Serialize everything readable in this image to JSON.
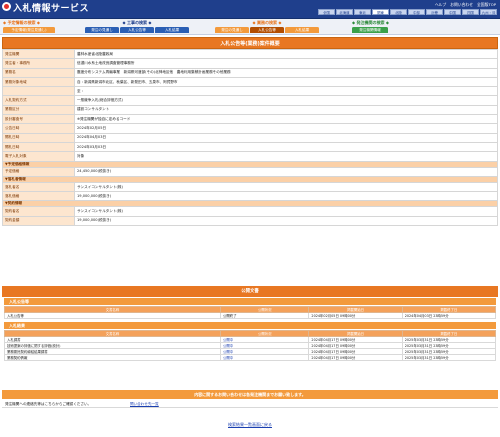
{
  "header": {
    "title": "入札情報サービス",
    "toplinks": [
      "ヘルプ",
      "お問い合わせ",
      "全国版TOP"
    ],
    "regions": [
      "全国",
      "北海道",
      "東北",
      "関東",
      "北陸",
      "中部",
      "近畿",
      "中国",
      "四国",
      "九州・沖縄"
    ],
    "selected_region": "関東"
  },
  "menu": {
    "groups": [
      {
        "head": "◆ 予定情報の検索 ◆",
        "tabs": [
          "予定情報(発注見通し)"
        ]
      },
      {
        "head": "◆ 工事の検索 ◆",
        "tabs": [
          "発注の見通し",
          "入札公告等",
          "入札結果"
        ]
      },
      {
        "head": "◆ 業務の検索 ◆",
        "tabs": [
          "発注の見通し",
          "入札公告等",
          "入札結果"
        ]
      },
      {
        "head": "◆ 発注機関の検索 ◆",
        "tabs": [
          "発注機関情報"
        ]
      }
    ]
  },
  "main": {
    "title": "入札公告等(業務)案件概要",
    "rows": [
      {
        "k": "発注機関",
        "v": "農林水産省北陸農政局"
      },
      {
        "k": "発注者・事務所",
        "v": "信濃川水系土地改良調査管理事務所"
      },
      {
        "k": "業務名",
        "v": "震度分布システム再編事業　新潟県河渡部(その)北神地区他　農地利用集積計画業務その他業務"
      },
      {
        "k": "業務対象地域",
        "v": "自 : 新潟県新潟市北区、秋葉区、新発田市、五泉市、阿賀野市"
      },
      {
        "k": "",
        "v": "至 :"
      },
      {
        "k": "入札契約方式",
        "v": "一般競争入札(総合評価方式)"
      },
      {
        "k": "業務区分",
        "v": "建設コンサルタント"
      },
      {
        "k": "設計審査号",
        "v": "※発注機関が独自に定めるコード"
      },
      {
        "k": "公告日時",
        "v": "2024年02月05日"
      },
      {
        "k": "開札日時",
        "v": "2024年04月03日"
      },
      {
        "k": "開札日時",
        "v": "2024年03月03日"
      },
      {
        "k": "電子入札対象",
        "v": "対象"
      },
      {
        "section": "▼予定価格情報"
      },
      {
        "k": "予定価格",
        "v": "24,450,000(税抜き)"
      },
      {
        "section": "▼落札者情報"
      },
      {
        "k": "落札者名",
        "v": "サンスイコンサルタント(株)"
      },
      {
        "k": "落札価格",
        "v": "19,000,000(税抜き)"
      },
      {
        "section": "▼契約情報"
      },
      {
        "k": "契約者名",
        "v": "サンスイコンサルタント(株)"
      },
      {
        "k": "契約金額",
        "v": "19,000,000(税抜き)"
      }
    ]
  },
  "documents": {
    "title": "公開文書",
    "notice": {
      "label": "入札公告等",
      "headers": [
        "文書名称",
        "公開状況",
        "掲載開始日",
        "掲載終了日"
      ],
      "rows": [
        [
          "入札公告等",
          "公開終了",
          "2024年02月05日 09時00分",
          "2024年04月03日 23時59分"
        ]
      ]
    },
    "results": {
      "label": "入札結果",
      "headers": [
        "文書名称",
        "公開状況",
        "掲載開始日",
        "掲載終了日"
      ],
      "rows": [
        [
          "入札調書",
          "公開中",
          "2024年04月17日 09時00分",
          "2025年03月31日 23時59分"
        ],
        [
          "技術提案の評価に関する評価(設計)",
          "公開中",
          "2024年04月17日 09時00分",
          "2025年03月31日 23時59分"
        ],
        [
          "業務委託契約締結結果調書",
          "公開中",
          "2024年04月17日 09時00分",
          "2025年03月31日 23時59分"
        ],
        [
          "業務契約情報",
          "公開中",
          "2024年04月17日 09時00分",
          "2025年03月31日 23時59分"
        ]
      ]
    }
  },
  "inquiry": {
    "title": "内容に関するお問い合わせは各発注機関までお願い致します。",
    "text": "発注機関への連絡先等はこちらからご確認ください。",
    "link": "問い合わせ先一覧"
  },
  "back_link": "検索結果一覧画面に戻る"
}
